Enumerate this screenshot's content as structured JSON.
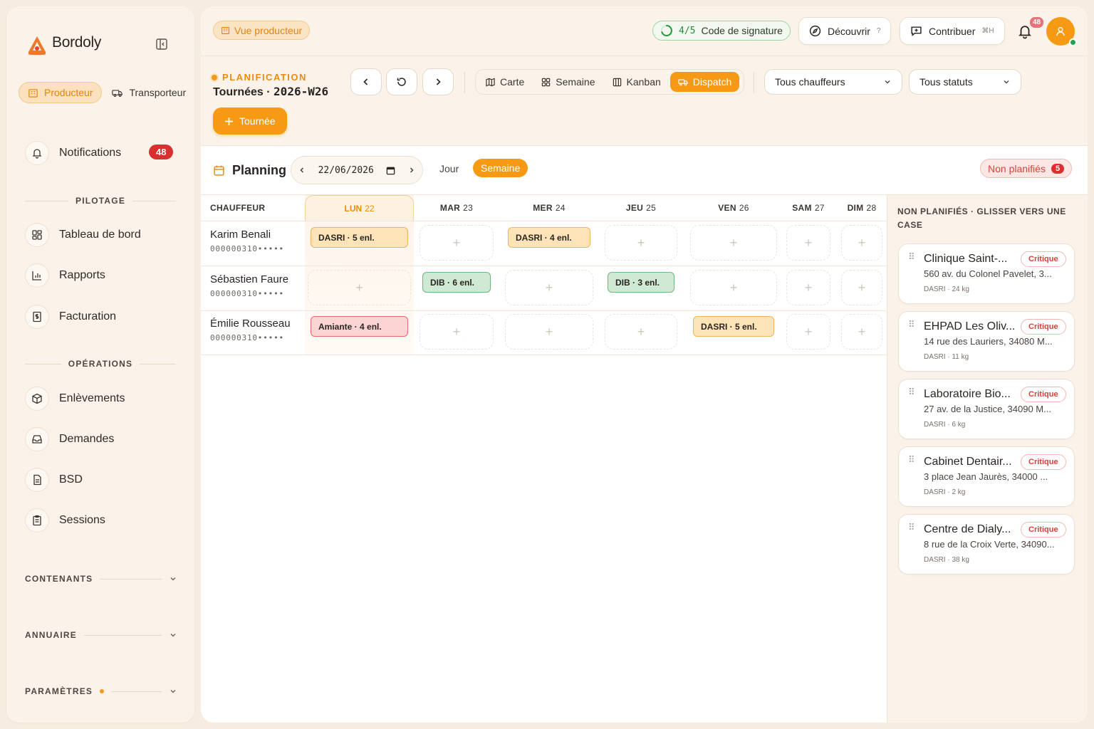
{
  "sidebar": {
    "brand": {
      "name": "Bordoly",
      "tagline": ""
    },
    "roles": [
      {
        "label": "Producteur",
        "icon": "building-icon",
        "active": true
      },
      {
        "label": "Transporteur",
        "icon": "truck-icon",
        "active": false
      }
    ],
    "notifications": {
      "label": "Notifications",
      "count": "48"
    },
    "section_pilotage": "PILOTAGE",
    "pilotage_items": [
      {
        "label": "Tableau de bord",
        "icon": "dashboard-icon"
      },
      {
        "label": "Rapports",
        "icon": "chart-icon"
      },
      {
        "label": "Facturation",
        "icon": "invoice-icon"
      }
    ],
    "section_operations": "OPÉRATIONS",
    "operations_items": [
      {
        "label": "Enlèvements",
        "icon": "package-icon"
      },
      {
        "label": "Demandes",
        "icon": "inbox-icon"
      },
      {
        "label": "BSD",
        "icon": "document-icon"
      },
      {
        "label": "Sessions",
        "icon": "clipboard-icon"
      }
    ],
    "collapsibles": [
      {
        "label": "CONTENANTS",
        "dot": false
      },
      {
        "label": "ANNUAIRE",
        "dot": false
      },
      {
        "label": "PARAMÈTRES",
        "dot": true
      }
    ]
  },
  "topbar": {
    "view_label": "Vue producteur",
    "signature": {
      "count": "4/5",
      "label": "Code de signature"
    },
    "discover": {
      "label": "Découvrir",
      "shortcut": "?"
    },
    "contribute": {
      "label": "Contribuer",
      "shortcut": "⌘H"
    },
    "notif_count": "48"
  },
  "toolbar": {
    "kicker": "PLANIFICATION",
    "title_prefix": "Tournées · ",
    "week": "2026-W26",
    "views": [
      {
        "label": "Carte",
        "icon": "map-icon",
        "active": false
      },
      {
        "label": "Semaine",
        "icon": "grid-icon",
        "active": false
      },
      {
        "label": "Kanban",
        "icon": "kanban-icon",
        "active": false
      },
      {
        "label": "Dispatch",
        "icon": "dispatch-icon",
        "active": true
      }
    ],
    "driver_filter": "Tous chauffeurs",
    "status_filter": "Tous statuts",
    "add_label": "Tournée"
  },
  "planning": {
    "title": "Planning",
    "date": "22/06/2026",
    "mode_day": "Jour",
    "mode_week": "Semaine",
    "unplanned_label": "Non planifiés",
    "unplanned_count": "5",
    "col_driver": "CHAUFFEUR",
    "days": [
      {
        "dow": "LUN",
        "num": "22",
        "today": true
      },
      {
        "dow": "MAR",
        "num": "23",
        "today": false
      },
      {
        "dow": "MER",
        "num": "24",
        "today": false
      },
      {
        "dow": "JEU",
        "num": "25",
        "today": false
      },
      {
        "dow": "VEN",
        "num": "26",
        "today": false
      },
      {
        "dow": "SAM",
        "num": "27",
        "today": false
      },
      {
        "dow": "DIM",
        "num": "28",
        "today": false
      }
    ],
    "drivers": [
      {
        "name": "Karim Benali",
        "phone": "000000310•••••",
        "slots": [
          "DASRI · 5 enl.",
          "",
          "DASRI · 4 enl.",
          "",
          "",
          "",
          ""
        ],
        "kinds": [
          "dasri",
          "",
          "dasri",
          "",
          "",
          "",
          ""
        ]
      },
      {
        "name": "Sébastien Faure",
        "phone": "000000310•••••",
        "slots": [
          "",
          "DIB · 6 enl.",
          "",
          "DIB · 3 enl.",
          "",
          "",
          ""
        ],
        "kinds": [
          "",
          "dib",
          "",
          "dib",
          "",
          "",
          ""
        ]
      },
      {
        "name": "Émilie Rousseau",
        "phone": "000000310•••••",
        "slots": [
          "Amiante · 4 enl.",
          "",
          "",
          "",
          "DASRI · 5 enl.",
          "",
          ""
        ],
        "kinds": [
          "amiante",
          "",
          "",
          "",
          "dasri",
          "",
          ""
        ]
      }
    ]
  },
  "unplanned": {
    "title": "NON PLANIFIÉS · GLISSER VERS UNE CASE",
    "items": [
      {
        "name": "Clinique Saint-...",
        "badge": "Critique",
        "address": "560 av. du Colonel Pavelet, 3...",
        "meta": "DASRI · 24 kg"
      },
      {
        "name": "EHPAD Les Oliv...",
        "badge": "Critique",
        "address": "14 rue des Lauriers, 34080 M...",
        "meta": "DASRI · 11 kg"
      },
      {
        "name": "Laboratoire Bio...",
        "badge": "Critique",
        "address": "27 av. de la Justice, 34090 M...",
        "meta": "DASRI · 6 kg"
      },
      {
        "name": "Cabinet Dentair...",
        "badge": "Critique",
        "address": "3 place Jean Jaurès, 34000 ...",
        "meta": "DASRI · 2 kg"
      },
      {
        "name": "Centre de Dialy...",
        "badge": "Critique",
        "address": "8 rue de la Croix Verte, 34090...",
        "meta": "DASRI · 38 kg"
      }
    ]
  },
  "colors": {
    "accent": "#f59a12",
    "danger": "#d92f2f",
    "success": "#22a04b"
  }
}
